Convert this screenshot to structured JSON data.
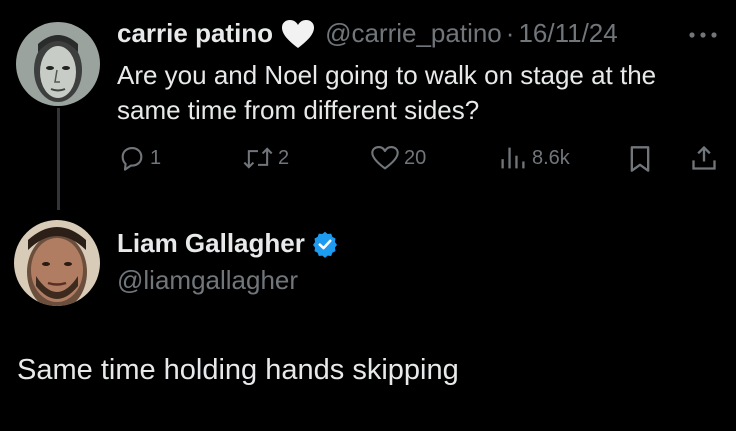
{
  "tweet": {
    "author_name": "carrie patino",
    "author_badge_icon": "heart-icon",
    "author_handle": "@carrie_patino",
    "separator": "·",
    "date": "16/11/24",
    "more_icon": "more-icon",
    "text": "Are you and Noel going to walk on stage at the same time from different sides?",
    "actions": {
      "replies": "1",
      "reposts": "2",
      "likes": "20",
      "views": "8.6k"
    }
  },
  "reply": {
    "author_name": "Liam Gallagher",
    "author_badge_icon": "verified-badge-icon",
    "author_handle": "@liamgallagher",
    "text": "Same time holding hands skipping"
  },
  "colors": {
    "background": "#000000",
    "text": "#e7e9ea",
    "muted": "#71767b",
    "verified": "#1d9bf0"
  }
}
